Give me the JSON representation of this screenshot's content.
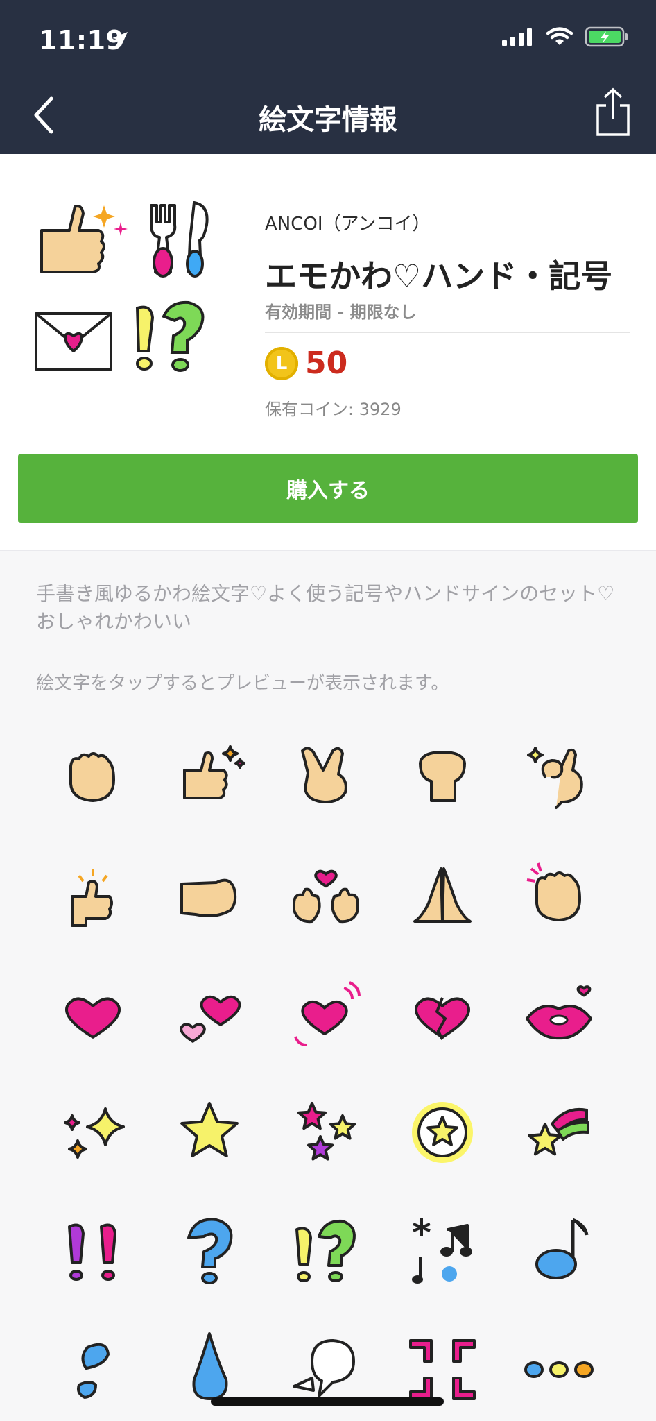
{
  "status": {
    "time": "11:19"
  },
  "nav": {
    "title": "絵文字情報"
  },
  "product": {
    "publisher": "ANCOI（アンコイ）",
    "name": "エモかわ♡ハンド・記号",
    "validity": "有効期間 - 期限なし",
    "coin_letter": "L",
    "price": "50",
    "owned_coins": "保有コイン: 3929"
  },
  "buy_label": "購入する",
  "description": "手書き風ゆるかわ絵文字♡よく使う記号やハンドサインのセット♡おしゃれかわいい",
  "preview_hint": "絵文字をタップするとプレビューが表示されます。",
  "emoji_grid": [
    [
      "fist-hand",
      "thumbs-up-sparkle",
      "peace-sign-hand",
      "raised-fist",
      "ok-hand-sparkle"
    ],
    [
      "thumbs-up-shine",
      "pointing-hand",
      "hands-heart",
      "praying-hands",
      "clenched-hand-pink"
    ],
    [
      "pink-heart",
      "two-hearts",
      "beating-heart",
      "broken-heart",
      "pink-lips"
    ],
    [
      "sparkles",
      "yellow-star",
      "three-stars",
      "glowing-star",
      "shooting-star"
    ],
    [
      "double-exclamation",
      "question-mark",
      "exclamation-question",
      "music-notes",
      "music-note"
    ],
    [
      "water-drops",
      "water-drop",
      "speech-bubble",
      "anger-symbol",
      "ellipsis-dots"
    ]
  ],
  "colors": {
    "header": "#283042",
    "buy": "#56b23c",
    "price": "#cc2b1e",
    "coin": "#f2c41a"
  }
}
